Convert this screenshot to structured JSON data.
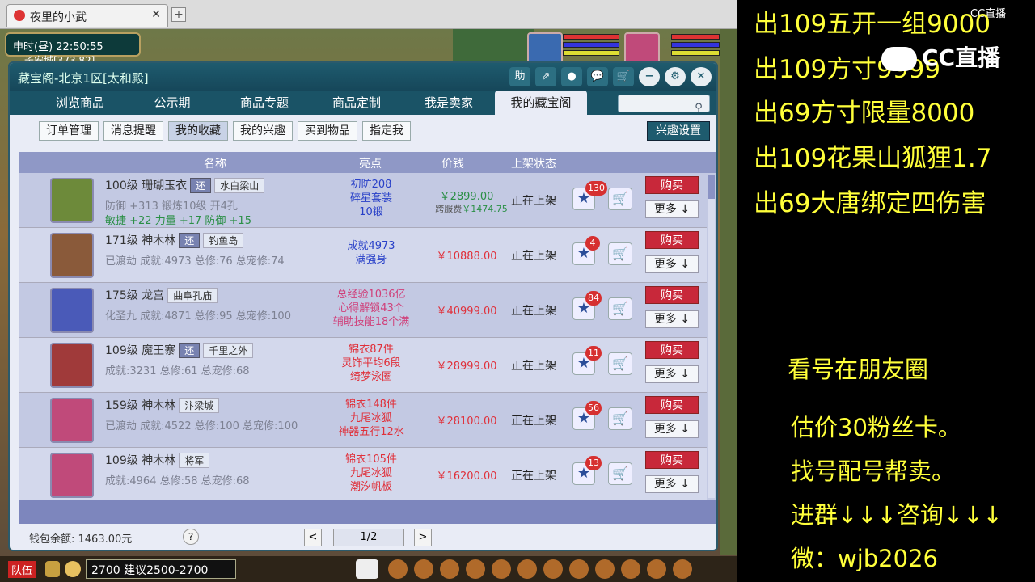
{
  "browser": {
    "tab_title": "夜里的小武",
    "close": "✕",
    "new_tab": "+"
  },
  "game": {
    "clock": "申时(昼)  22:50:55",
    "location": "长安城[373,82]"
  },
  "window": {
    "title": "藏宝阁-北京1区[太和殿]",
    "toolbar": [
      "助",
      "⇗",
      "●",
      "💬",
      "🛒"
    ],
    "window_buttons": [
      "−",
      "⚙",
      "✕"
    ],
    "tabs": [
      "浏览商品",
      "公示期",
      "商品专题",
      "商品定制",
      "我是卖家",
      "我的藏宝阁"
    ],
    "subtabs": [
      "订单管理",
      "消息提醒",
      "我的收藏",
      "我的兴趣",
      "买到物品",
      "指定我"
    ],
    "settings_button": "兴趣设置",
    "columns": {
      "name": "名称",
      "highlight": "亮点",
      "price": "价钱",
      "status": "上架状态"
    },
    "rows": [
      {
        "level": "100级",
        "school": "珊瑚玉衣",
        "huan": "还",
        "server": "水白梁山",
        "line2": "防御 +313 锻炼10级 开4孔",
        "line3": "敏捷 +22 力量 +17 防御 +15",
        "hl": [
          "初防208",
          "碎星套装",
          "10锻"
        ],
        "hl_color": "#2840c8",
        "price": "￥2899.00",
        "fee_label": "跨服费",
        "fee": "￥1474.75",
        "status": "正在上架",
        "fav_count": "130",
        "buy": "购买",
        "more": "更多 ↓",
        "avatar_color": "#6d8a3a"
      },
      {
        "level": "171级",
        "school": "神木林",
        "huan": "还",
        "server": "钓鱼岛",
        "line2": "已渡劫  成就:4973 总修:76 总宠修:74",
        "line3": "",
        "hl": [
          "成就4973",
          "满强身"
        ],
        "hl_color": "#2840c8",
        "price": "￥10888.00",
        "fee_label": "",
        "fee": "",
        "status": "正在上架",
        "fav_count": "4",
        "buy": "购买",
        "more": "更多 ↓",
        "avatar_color": "#8a5a3a"
      },
      {
        "level": "175级",
        "school": "龙宫",
        "huan": "",
        "server": "曲阜孔庙",
        "line2": "化圣九  成就:4871 总修:95 总宠修:100",
        "line3": "",
        "hl": [
          "总经验1036亿",
          "心得解锁43个",
          "辅助技能18个满"
        ],
        "hl_color": "#d0407a",
        "price": "￥40999.00",
        "fee_label": "",
        "fee": "",
        "status": "正在上架",
        "fav_count": "84",
        "buy": "购买",
        "more": "更多 ↓",
        "avatar_color": "#4a5ab8"
      },
      {
        "level": "109级",
        "school": "魔王寨",
        "huan": "还",
        "server": "千里之外",
        "line2": "成就:3231 总修:61 总宠修:68",
        "line3": "",
        "hl": [
          "锦衣87件",
          "灵饰平均6段",
          "绮梦泳圈"
        ],
        "hl_color": "#e0303a",
        "price": "￥28999.00",
        "fee_label": "",
        "fee": "",
        "status": "正在上架",
        "fav_count": "11",
        "buy": "购买",
        "more": "更多 ↓",
        "avatar_color": "#a03a3a"
      },
      {
        "level": "159级",
        "school": "神木林",
        "huan": "",
        "server": "汴梁城",
        "line2": "已渡劫  成就:4522 总修:100 总宠修:100",
        "line3": "",
        "hl": [
          "锦衣148件",
          "九尾冰狐",
          "神器五行12水"
        ],
        "hl_color": "#e0303a",
        "price": "￥28100.00",
        "fee_label": "",
        "fee": "",
        "status": "正在上架",
        "fav_count": "56",
        "buy": "购买",
        "more": "更多 ↓",
        "avatar_color": "#c04a7a"
      },
      {
        "level": "109级",
        "school": "神木林",
        "huan": "",
        "server": "将军",
        "line2": "成就:4964 总修:58 总宠修:68",
        "line3": "",
        "hl": [
          "锦衣105件",
          "九尾冰狐",
          "潮汐帆板"
        ],
        "hl_color": "#e0303a",
        "price": "￥16200.00",
        "fee_label": "",
        "fee": "",
        "status": "正在上架",
        "fav_count": "13",
        "buy": "购买",
        "more": "更多 ↓",
        "avatar_color": "#c04a7a"
      }
    ],
    "wallet": "钱包余额: 1463.00元",
    "help": "?",
    "prev": "<",
    "page": "1/2",
    "next": ">"
  },
  "hud": {
    "team": "队伍",
    "chat": "2700  建议2500-2700"
  },
  "side": {
    "cc_small": "CC直播",
    "cc_big": "CC直播",
    "ads": [
      "出109五开一组9000",
      "出109方寸9999",
      "出69方寸限量8000",
      "出109花果山狐狸1.7",
      "出69大唐绑定四伤害"
    ],
    "note1": "看号在朋友圈",
    "note2": "估价30粉丝卡。",
    "note3": "找号配号帮卖。",
    "note4": "进群↓↓↓咨询↓↓↓",
    "note5": "微：wjb2026"
  }
}
